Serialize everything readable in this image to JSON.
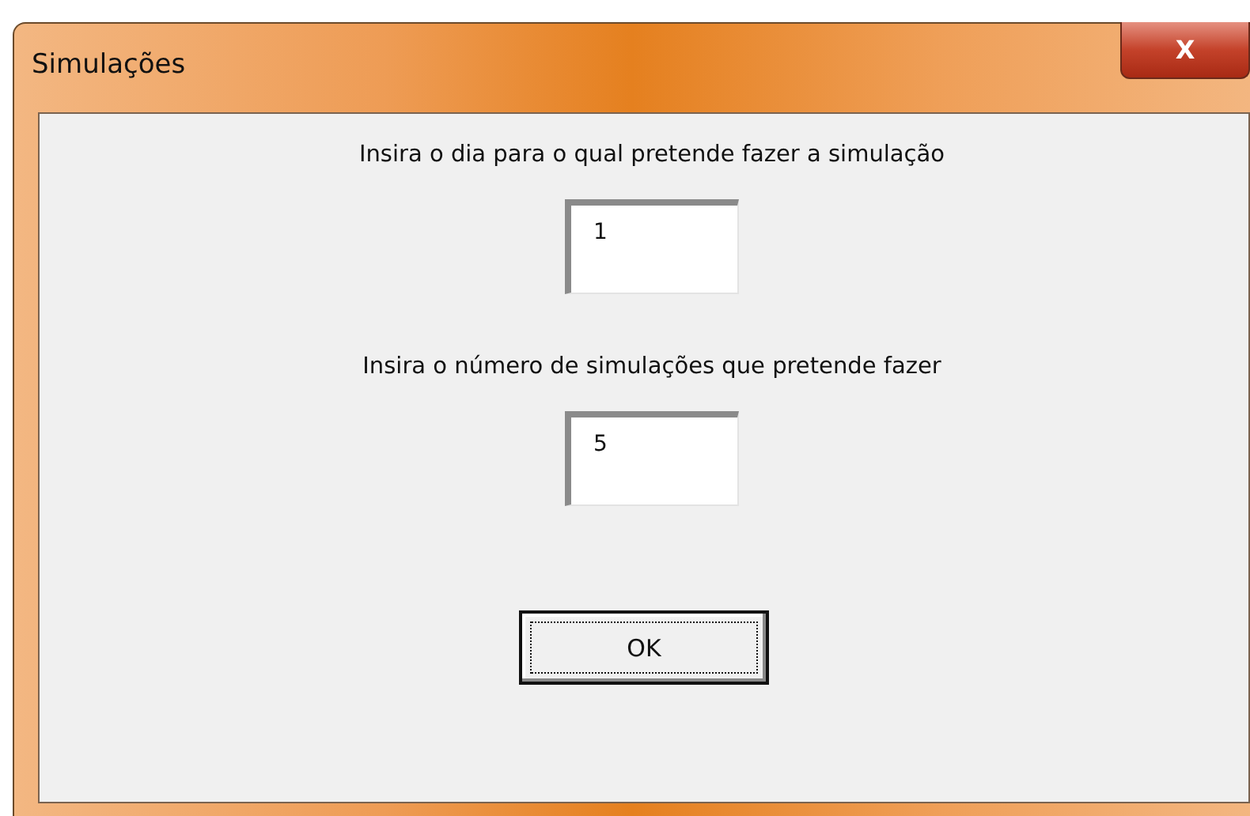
{
  "window": {
    "title": "Simulações",
    "close": "X"
  },
  "fields": [
    {
      "label": "Insira o dia para o qual pretende fazer a simulação",
      "value": "1"
    },
    {
      "label": "Insira o número de simulações que pretende fazer",
      "value": "5"
    }
  ],
  "buttons": [
    {
      "label": "OK",
      "focused": true
    }
  ]
}
